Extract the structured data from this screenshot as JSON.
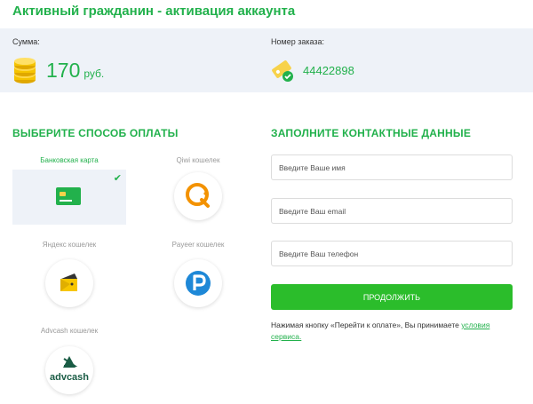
{
  "page": {
    "title": "Активный гражданин - активация аккаунта"
  },
  "summary": {
    "amount_label": "Сумма:",
    "amount_value": "170",
    "currency": "руб.",
    "order_label": "Номер заказа:",
    "order_value": "44422898"
  },
  "payment": {
    "title": "ВЫБЕРИТЕ СПОСОБ ОПЛАТЫ",
    "methods": [
      {
        "label": "Банковская карта",
        "icon": "bank-card-icon",
        "selected": true
      },
      {
        "label": "Qiwi кошелек",
        "icon": "qiwi-icon",
        "selected": false
      },
      {
        "label": "Яндекс кошелек",
        "icon": "yandex-wallet-icon",
        "selected": false
      },
      {
        "label": "Payeer кошелек",
        "icon": "payeer-icon",
        "selected": false
      },
      {
        "label": "Advcash кошелек",
        "icon": "advcash-icon",
        "logo_text": "advcash",
        "selected": false
      }
    ]
  },
  "contact": {
    "title": "ЗАПОЛНИТЕ КОНТАКТНЫЕ ДАННЫЕ",
    "name_placeholder": "Введите Ваше имя",
    "email_placeholder": "Введите Ваш email",
    "phone_placeholder": "Введите Ваш телефон",
    "submit_label": "ПРОДОЛЖИТЬ",
    "terms_text": "Нажимая кнопку «Перейти к оплате», Вы принимаете",
    "terms_link": "условия сервиса."
  },
  "colors": {
    "accent": "#22b14c",
    "button": "#2bbd2b",
    "panel": "#eef2f8",
    "qiwi": "#f39200",
    "payeer": "#1e88d7",
    "yandex": "#f7c600",
    "advcash": "#1a5c45"
  }
}
